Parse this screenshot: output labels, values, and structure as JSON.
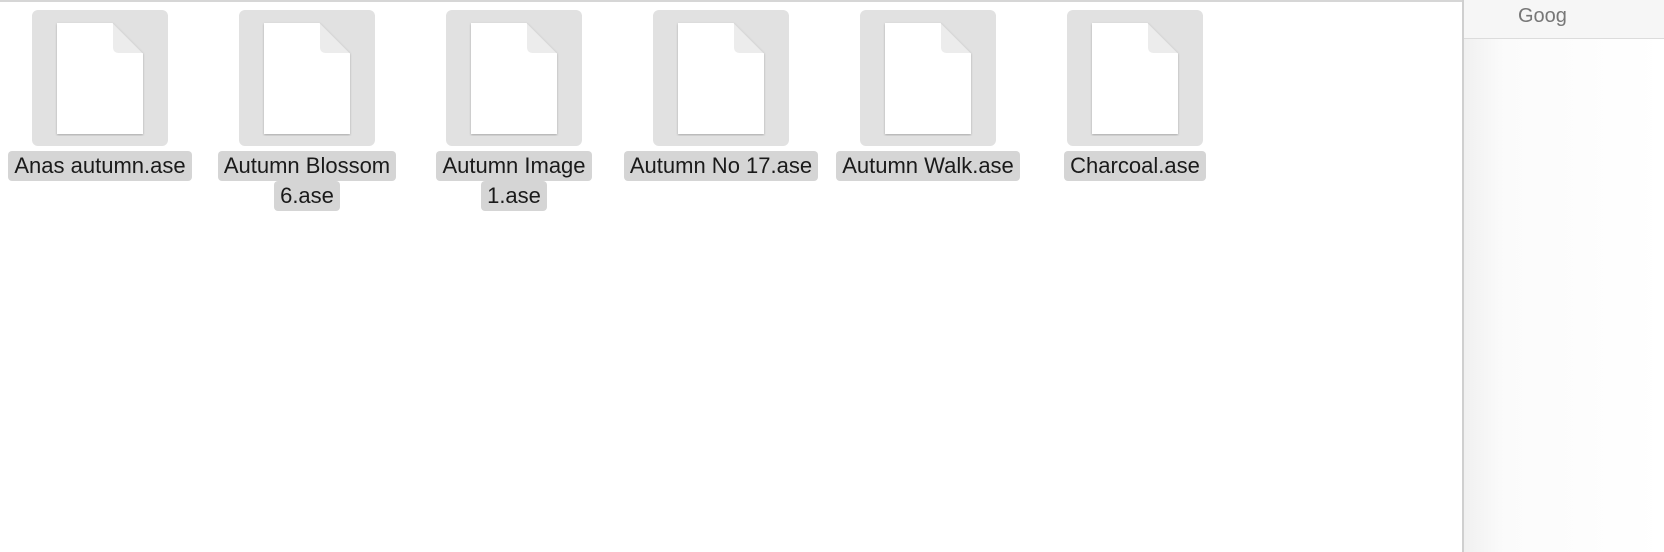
{
  "files": [
    {
      "name_lines": [
        "Anas autumn.ase"
      ],
      "icon": "document-icon"
    },
    {
      "name_lines": [
        "Autumn Blossom",
        "6.ase"
      ],
      "icon": "document-icon"
    },
    {
      "name_lines": [
        "Autumn Image",
        "1.ase"
      ],
      "icon": "document-icon"
    },
    {
      "name_lines": [
        "Autumn No 17.ase"
      ],
      "icon": "document-icon"
    },
    {
      "name_lines": [
        "Autumn Walk.ase"
      ],
      "icon": "document-icon"
    },
    {
      "name_lines": [
        "Charcoal.ase"
      ],
      "icon": "document-icon"
    }
  ],
  "sidebar": {
    "title": "Goog"
  },
  "colors": {
    "thumb_bg": "#e1e1e1",
    "label_bg": "#d5d5d5"
  }
}
